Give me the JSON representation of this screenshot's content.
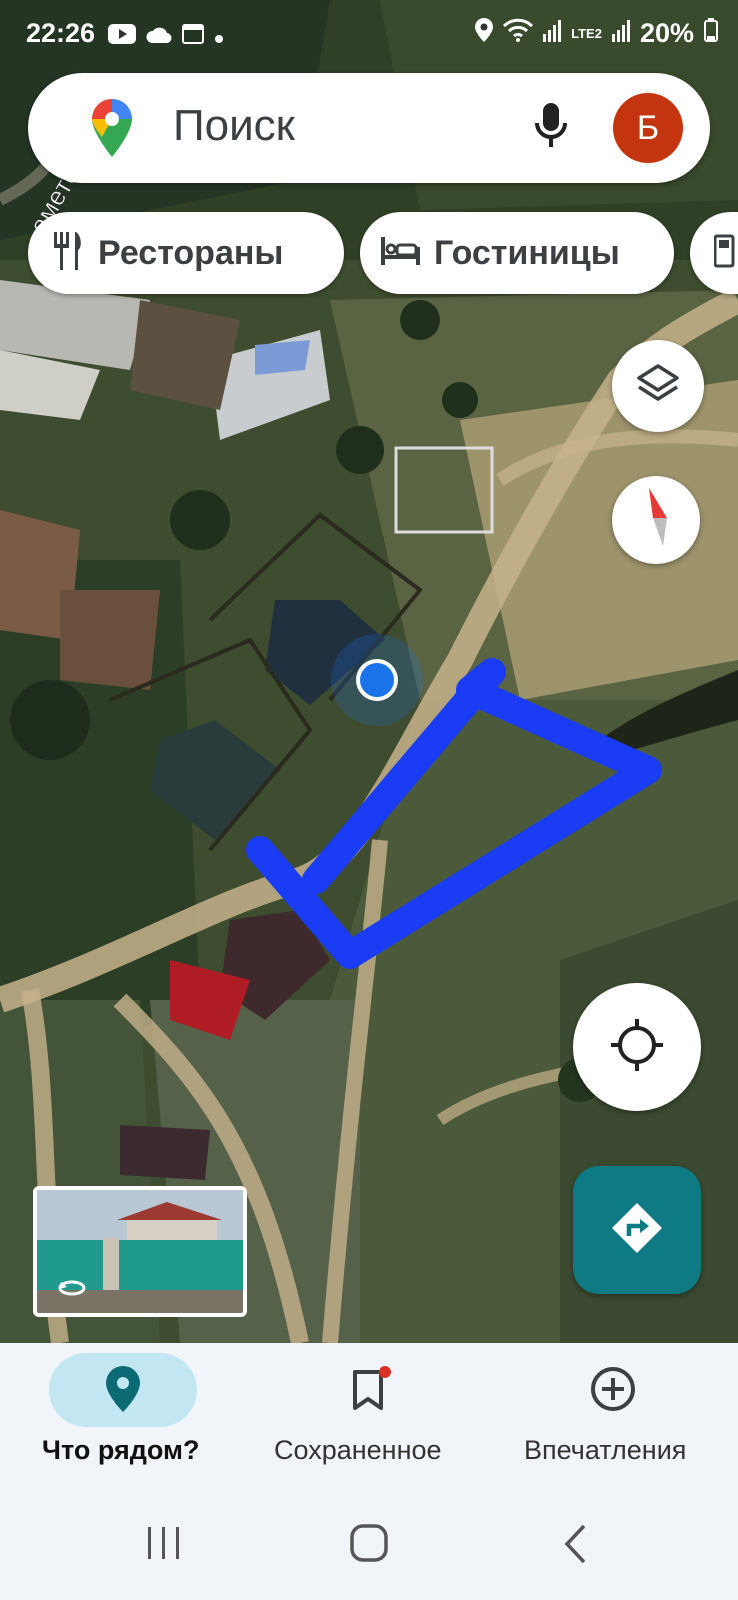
{
  "status_bar": {
    "time": "22:26",
    "battery": "20%",
    "network": "LTE2"
  },
  "search": {
    "placeholder": "Поиск",
    "avatar_letter": "Б"
  },
  "chips": [
    {
      "label": "Рестораны",
      "icon": "restaurant-icon"
    },
    {
      "label": "Гостиницы",
      "icon": "hotel-icon"
    },
    {
      "label": "",
      "icon": "gas-station-icon"
    }
  ],
  "map": {
    "road_label": "амето",
    "my_location_color": "#1a73e8",
    "drawn_outline_color": "#1a3cf5"
  },
  "bottom_nav": {
    "tabs": [
      {
        "label": "Что рядом?",
        "icon": "location-pin-icon",
        "active": true
      },
      {
        "label": "Сохраненное",
        "icon": "bookmark-icon",
        "active": false
      },
      {
        "label": "Впечатления",
        "icon": "add-circle-icon",
        "active": false
      }
    ]
  },
  "colors": {
    "directions_bg": "#0e7a83",
    "active_pill": "#c2e7f2",
    "avatar_bg": "#c4350f"
  }
}
